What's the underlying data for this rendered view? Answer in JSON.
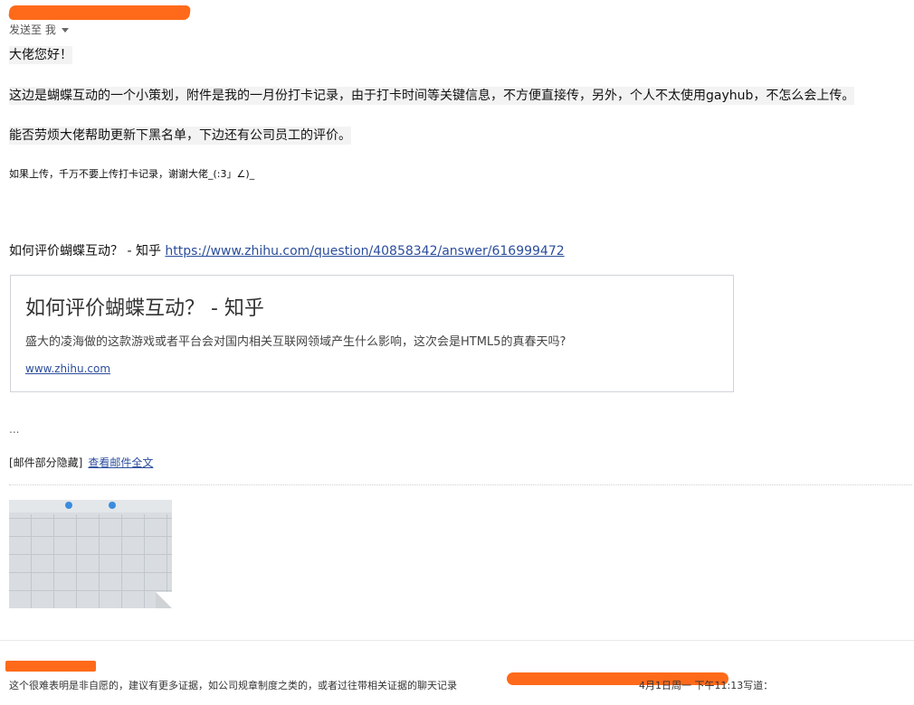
{
  "email": {
    "sender_line": "发送至 我",
    "greeting": "大佬您好！",
    "paragraph1": "这边是蝴蝶互动的一个小策划，附件是我的一月份打卡记录，由于打卡时间等关键信息，不方便直接传，另外，个人不太使用gayhub，不怎么会上传。",
    "paragraph2": "能否劳烦大佬帮助更新下黑名单，下边还有公司员工的评价。",
    "note": "如果上传，千万不要上传打卡记录，谢谢大佬_(:3」∠)_",
    "link_prefix": "如何评价蝴蝶互动？ - 知乎",
    "link_url": "https://www.zhihu.com/question/40858342/answer/616999472"
  },
  "preview_card": {
    "title": "如何评价蝴蝶互动？ - 知乎",
    "description": "盛大的凌海做的这款游戏或者平台会对国内相关互联网领域产生什么影响，这次会是HTML5的真春天吗?",
    "domain": "www.zhihu.com"
  },
  "ellipsis": "...",
  "hidden": {
    "label": "[邮件部分隐藏]",
    "view_full": "查看邮件全文"
  },
  "reply": {
    "text": "这个很难表明是非自愿的，建议有更多证据，如公司规章制度之类的，或者过往带相关证据的聊天记录",
    "date_text": "4月1日周一 下午11:13写道："
  },
  "colors": {
    "redaction": "#ff6a1a",
    "link": "#2b4d9c"
  }
}
